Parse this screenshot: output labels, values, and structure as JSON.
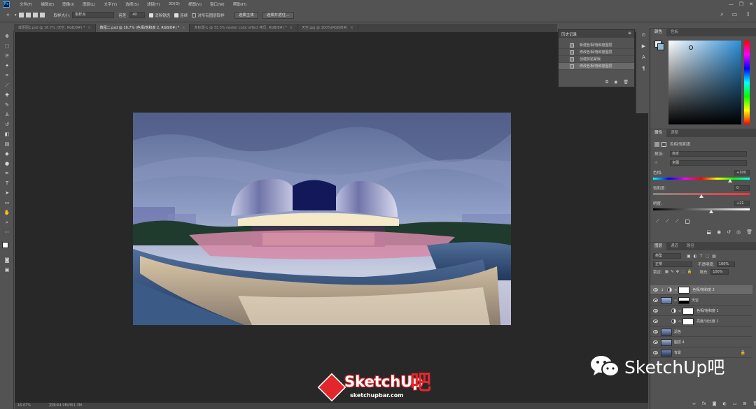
{
  "app": {
    "logo": "Ps"
  },
  "menu": [
    "文件(F)",
    "编辑(E)",
    "图像(I)",
    "图层(L)",
    "文字(Y)",
    "选择(S)",
    "滤镜(T)",
    "3D(D)",
    "视图(V)",
    "窗口(W)",
    "帮助(H)"
  ],
  "window_controls": {
    "minimize": "—",
    "restore": "❐",
    "close": "✕"
  },
  "options": {
    "sample_size_label": "取样大小:",
    "sample_size_value": "取样点",
    "tolerance_label": "容差:",
    "tolerance_value": "40",
    "antialias_label": "消除锯齿",
    "contiguous_label": "连续",
    "sample_all_label": "对所有图层取样",
    "select_subject_button": "选择主体",
    "select_mask_button": "选择并遮住..."
  },
  "tabs": [
    {
      "label": "或更图2.psd @ 16.7% (天空, RGB/8#) *",
      "active": false
    },
    {
      "label": "教程二.psd @ 16.7% (色相/饱和度 2, RGB/8#) *",
      "active": true
    },
    {
      "label": "未标题-1 @ 33.3% (water color effect 拷贝, RGB/8#) *",
      "active": false
    },
    {
      "label": "天空.jpg @ 100%(RGB/8#)",
      "active": false
    }
  ],
  "tab_close": "×",
  "status": {
    "zoom": "16.67%",
    "doc": "文档:64.9M/351.3M"
  },
  "history": {
    "title": "历史记录",
    "items": [
      {
        "label": "新建色相/饱和度图层",
        "selected": false
      },
      {
        "label": "修改色相/饱和度图层",
        "selected": false
      },
      {
        "label": "创建剪贴蒙版",
        "selected": false
      },
      {
        "label": "修改色相/饱和度图层",
        "selected": true
      }
    ]
  },
  "color_panel": {
    "tabs": [
      "颜色",
      "色板"
    ]
  },
  "properties": {
    "tabs": [
      "属性",
      "调整"
    ],
    "heading": "色相/饱和度",
    "preset_label": "预设:",
    "preset_value": "自定",
    "channel_value": "全图",
    "hue_label": "色相:",
    "hue_value": "+100",
    "sat_label": "饱和度:",
    "sat_value": "0",
    "light_label": "明度:",
    "light_value": "+21",
    "hue_level": 0.8,
    "sat_level": 0.5,
    "light_level": 0.6
  },
  "layers_panel": {
    "tabs": [
      "图层",
      "通道",
      "路径"
    ],
    "kind_label": "类型",
    "blend_mode": "正常",
    "opacity_label": "不透明度:",
    "opacity_value": "100%",
    "lock_label": "锁定:",
    "fill_label": "填充:",
    "fill_value": "100%",
    "layers": [
      {
        "name": "色相/饱和度 2",
        "type": "adjustment",
        "selected": true
      },
      {
        "name": "天空",
        "type": "image-mask",
        "selected": false
      },
      {
        "name": "色相/饱和度 1",
        "type": "adjustment",
        "selected": false
      },
      {
        "name": "亮度/对比度 1",
        "type": "adjustment",
        "selected": false
      },
      {
        "name": "滤色",
        "type": "image",
        "selected": false
      },
      {
        "name": "图层 4",
        "type": "image",
        "selected": false
      },
      {
        "name": "背景",
        "type": "image",
        "selected": false
      }
    ]
  },
  "watermark": {
    "wechat": "SketchUp吧",
    "brand": "SketchUp",
    "brand_char": "吧",
    "url": "sketchupbar.com"
  },
  "colors": {
    "accent": "#31a8ff",
    "panel": "#535353",
    "canvas": "#282828",
    "brand_red": "#e3262b"
  }
}
